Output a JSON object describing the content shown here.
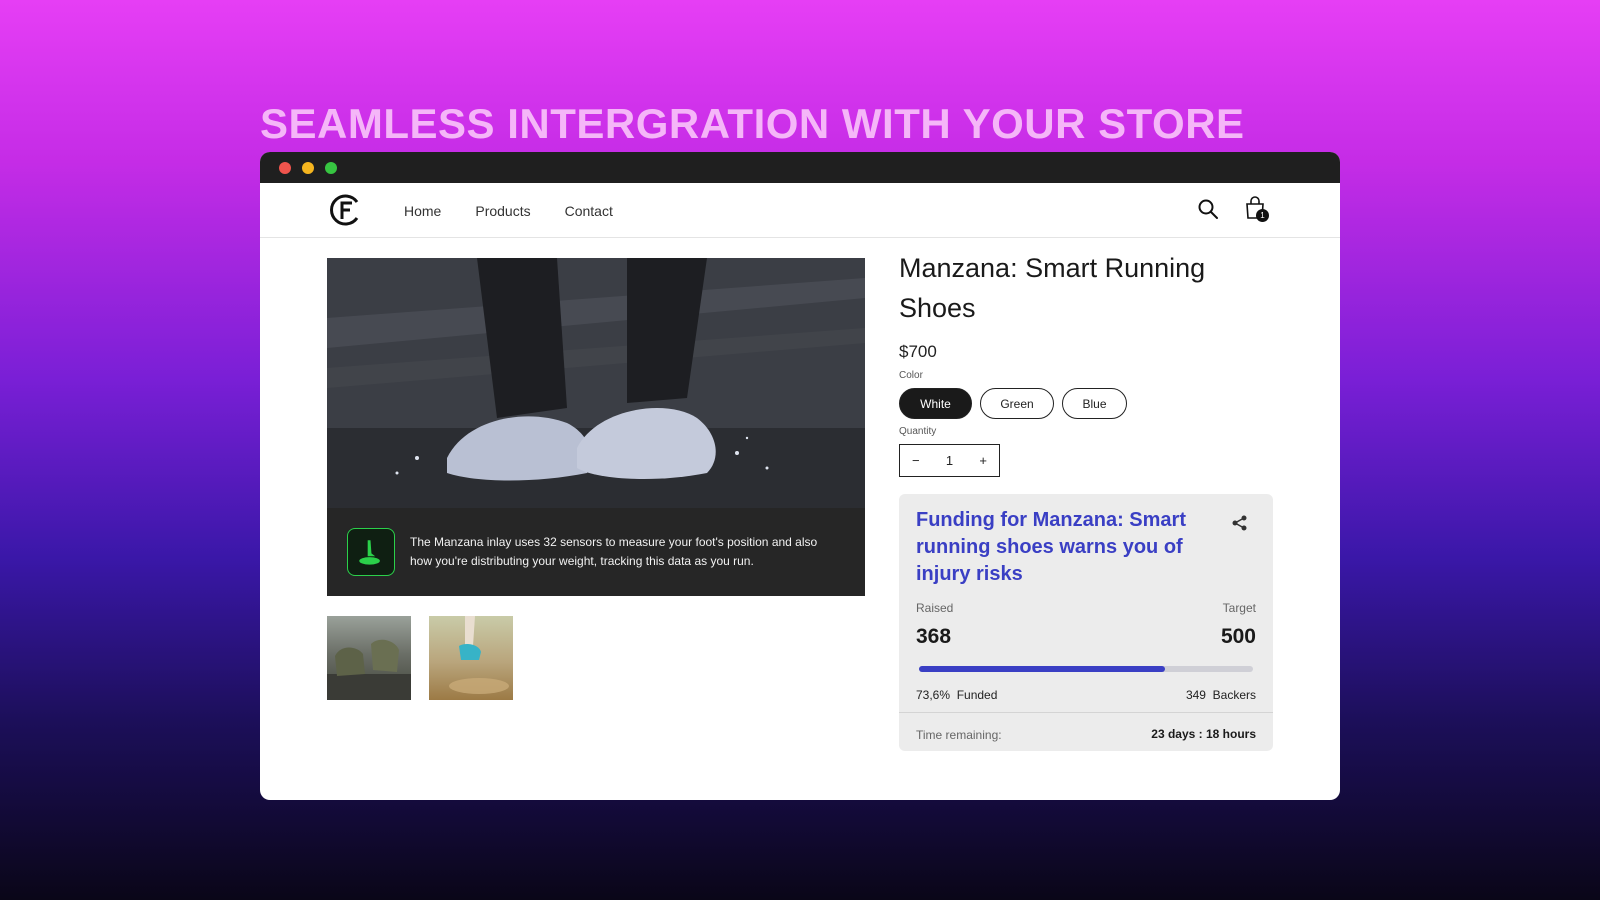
{
  "headline": "SEAMLESS INTERGRATION WITH YOUR STORE",
  "colors": {
    "accent": "#3a3fc4",
    "headline": "#f5b6f8",
    "titlebar": "#1f1f1f",
    "caption_icon_green": "#2bd04a"
  },
  "window_controls": [
    "close",
    "minimize",
    "maximize"
  ],
  "nav": {
    "links": [
      {
        "label": "Home"
      },
      {
        "label": "Products"
      },
      {
        "label": "Contact"
      }
    ],
    "search_icon": "search-icon",
    "cart_icon": "shopping-bag-icon",
    "cart_count": "1"
  },
  "hero": {
    "caption": "The Manzana inlay uses 32 sensors to measure your foot's position and also how you're distributing your weight, tracking this data as you run."
  },
  "product": {
    "title": "Manzana: Smart Running Shoes",
    "price": "$700",
    "color_label": "Color",
    "colors": [
      {
        "label": "White",
        "selected": true
      },
      {
        "label": "Green",
        "selected": false
      },
      {
        "label": "Blue",
        "selected": false
      }
    ],
    "quantity_label": "Quantity",
    "quantity": "1",
    "minus": "−",
    "plus": "+"
  },
  "funding": {
    "title": "Funding for Manzana: Smart running shoes warns you of injury risks",
    "raised_label": "Raised",
    "target_label": "Target",
    "raised": "368",
    "target": "500",
    "funded_percent": "73,6%",
    "funded_label": "Funded",
    "funded_fraction": 0.736,
    "backers_count": "349",
    "backers_label": "Backers",
    "time_label": "Time remaining:",
    "time_value": "23 days : 18 hours"
  }
}
